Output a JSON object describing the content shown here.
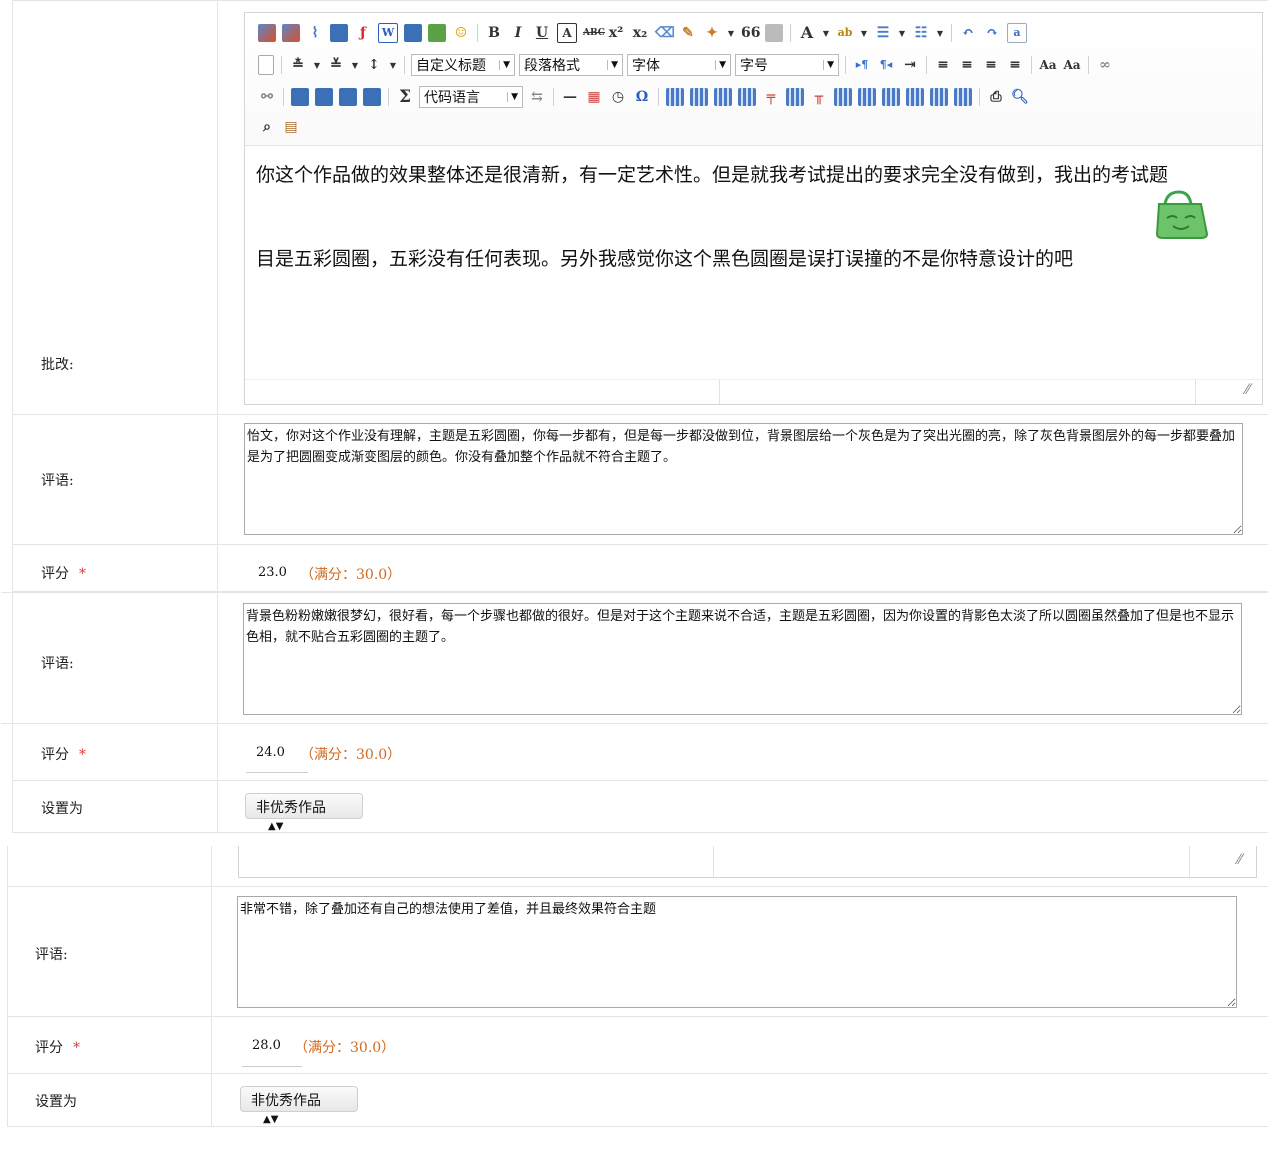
{
  "panel1": {
    "correction_label": "批改:",
    "editor": {
      "toolbar": {
        "custom_title": "自定义标题",
        "paragraph_format": "段落格式",
        "font_family": "字体",
        "font_size": "字号",
        "code_language": "代码语言",
        "bold": "B",
        "italic": "I",
        "underline": "U",
        "sigma": "Σ",
        "omega": "Ω",
        "font_color": "A",
        "quote": "66"
      },
      "content_line1": "你这个作品做的效果整体还是很清新，有一定艺术性。但是就我考试提出的要求完全没有做到，我出的考试题",
      "content_line2": "目是五彩圆圈，五彩没有任何表现。另外我感觉你这个黑色圆圈是误打误撞的不是你特意设计的吧"
    },
    "comment1": {
      "label": "评语:",
      "text": "怡文，你对这个作业没有理解，主题是五彩圆圈，你每一步都有，但是每一步都没做到位，背景图层给一个灰色是为了突出光圈的亮，除了灰色背景图层外的每一步都要叠加是为了把圆圈变成渐变图层的颜色。你没有叠加整个作品就不符合主题了。"
    },
    "score1": {
      "label": "评分",
      "value": "23.0",
      "full": "（满分：30.0）"
    },
    "comment2": {
      "label": "评语:",
      "text": "背景色粉粉嫩嫩很梦幻，很好看，每一个步骤也都做的很好。但是对于这个主题来说不合适，主题是五彩圆圈，因为你设置的背影色太淡了所以圆圈虽然叠加了但是也不显示色相，就不贴合五彩圆圈的主题了。"
    },
    "score2": {
      "label": "评分",
      "value": "24.0",
      "full": "（满分：30.0）"
    },
    "setas": {
      "label": "设置为",
      "selected": "非优秀作品"
    }
  },
  "panel2": {
    "comment": {
      "label": "评语:",
      "text": "非常不错，除了叠加还有自己的想法使用了差值，并且最终效果符合主题"
    },
    "score": {
      "label": "评分",
      "value": "28.0",
      "full": "（满分：30.0）"
    },
    "setas": {
      "label": "设置为",
      "selected": "非优秀作品"
    }
  },
  "colors": {
    "required_star": "#e4393c",
    "full_score": "#d2691e",
    "border": "#e4e4e4"
  }
}
